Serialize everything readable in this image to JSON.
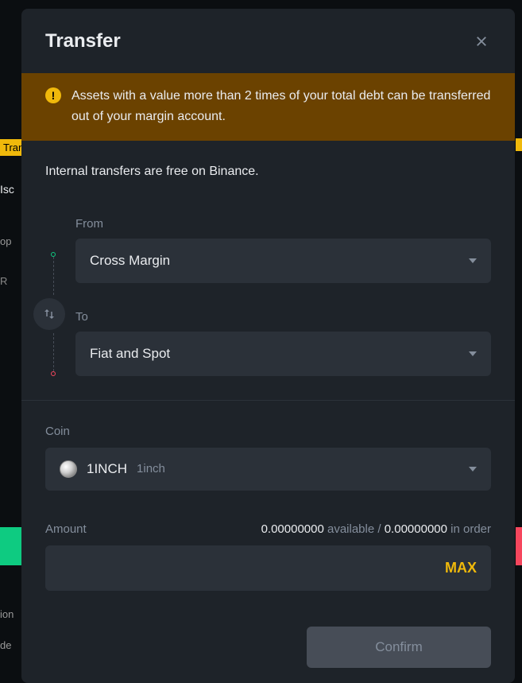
{
  "modal": {
    "title": "Transfer",
    "warning_text": "Assets with a value more than 2 times of your total debt can be transferred out of your margin account.",
    "info_text": "Internal transfers are free on Binance.",
    "from": {
      "label": "From",
      "value": "Cross Margin"
    },
    "to": {
      "label": "To",
      "value": "Fiat and Spot"
    },
    "coin": {
      "label": "Coin",
      "symbol": "1INCH",
      "name": "1inch"
    },
    "amount": {
      "label": "Amount",
      "available_value": "0.00000000",
      "available_label": "available",
      "separator": "/",
      "in_order_value": "0.00000000",
      "in_order_label": "in order",
      "max_label": "MAX"
    },
    "confirm_label": "Confirm"
  },
  "bg": {
    "trans": "Tran",
    "iso": "Isc",
    "op": "op",
    "r": "R",
    "ion": "ion",
    "de": "de"
  }
}
